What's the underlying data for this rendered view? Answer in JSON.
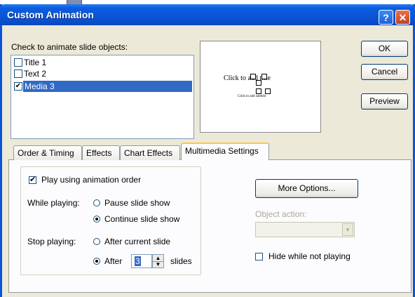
{
  "window": {
    "title": "Custom Animation",
    "help_glyph": "?",
    "close_glyph": "✕"
  },
  "objects": {
    "label": "Check to animate slide objects:",
    "items": [
      {
        "label": "Title 1",
        "checked": false,
        "mark": ""
      },
      {
        "label": "Text 2",
        "checked": false,
        "mark": ""
      },
      {
        "label": "Media 3",
        "checked": true,
        "mark": "✔"
      }
    ]
  },
  "preview_slide": {
    "title_text": "Click to add title",
    "subtitle_text": "Click to add subtitle"
  },
  "buttons": {
    "ok": "OK",
    "cancel": "Cancel",
    "preview": "Preview",
    "more_options": "More Options..."
  },
  "tabs": [
    {
      "label": "Order & Timing",
      "active": false
    },
    {
      "label": "Effects",
      "active": false
    },
    {
      "label": "Chart Effects",
      "active": false
    },
    {
      "label": "Multimedia Settings",
      "active": true
    }
  ],
  "multimedia": {
    "play_order_label": "Play using animation order",
    "play_order_checked": true,
    "play_order_mark": "✔",
    "while_playing_label": "While playing:",
    "pause_label": "Pause slide show",
    "continue_label": "Continue slide show",
    "while_playing_selected": "Continue slide show",
    "stop_playing_label": "Stop playing:",
    "after_current_label": "After current slide",
    "after_label": "After",
    "stop_selected": "After",
    "after_value": "3",
    "slides_label": "slides",
    "spin_up": "▲",
    "spin_down": "▼",
    "object_action_label": "Object action:",
    "object_action_value": "",
    "combo_arrow": "▼",
    "hide_label": "Hide while not playing",
    "hide_checked": false
  }
}
